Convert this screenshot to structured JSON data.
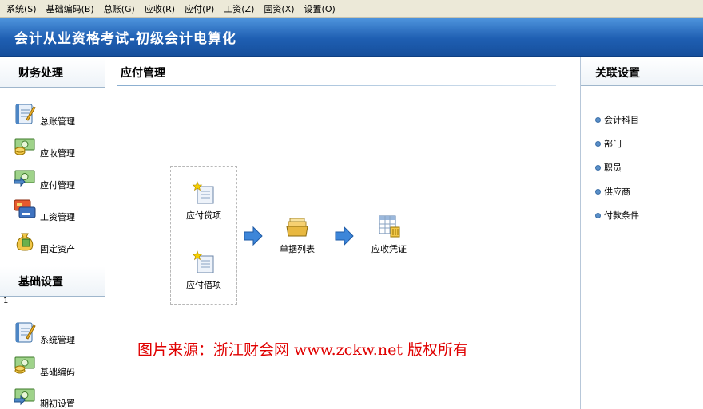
{
  "menu": [
    "系统(S)",
    "基础编码(B)",
    "总账(G)",
    "应收(R)",
    "应付(P)",
    "工资(Z)",
    "固资(X)",
    "设置(O)"
  ],
  "banner": {
    "title": "会计从业资格考试-初级会计电算化"
  },
  "sidebar": {
    "section1_title": "财务处理",
    "section1_items": [
      {
        "label": "总账管理",
        "icon": "notepad-icon"
      },
      {
        "label": "应收管理",
        "icon": "money-icon"
      },
      {
        "label": "应付管理",
        "icon": "money-exchange-icon"
      },
      {
        "label": "工资管理",
        "icon": "card-icon"
      },
      {
        "label": "固定资产",
        "icon": "money-bag-icon"
      }
    ],
    "section2_title": "基础设置",
    "section2_mark": "1",
    "section2_items": [
      {
        "label": "系统管理",
        "icon": "notepad-icon"
      },
      {
        "label": "基础编码",
        "icon": "money-icon"
      },
      {
        "label": "期初设置",
        "icon": "money-exchange-icon"
      }
    ]
  },
  "main": {
    "title": "应付管理",
    "flow": {
      "credit": "应付贷项",
      "debit": "应付借项",
      "list": "单据列表",
      "voucher": "应收凭证"
    },
    "watermark": "图片来源：浙江财会网 www.zckw.net 版权所有"
  },
  "right": {
    "title": "关联设置",
    "items": [
      "会计科目",
      "部门",
      "职员",
      "供应商",
      "付款条件"
    ]
  },
  "colors": {
    "banner": "#1f5fb2",
    "accent": "#5a8fc8",
    "watermark": "#e00000"
  }
}
